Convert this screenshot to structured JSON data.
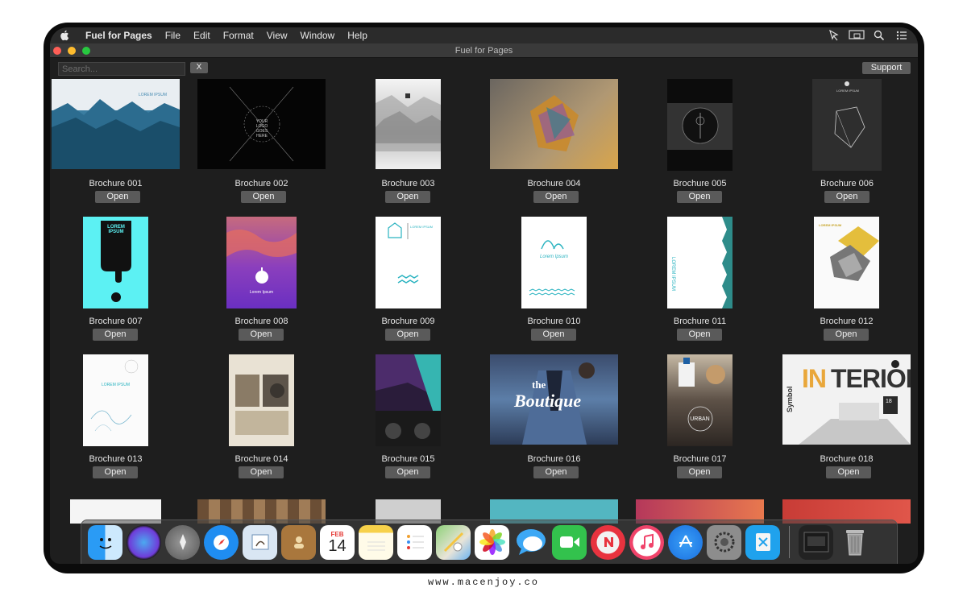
{
  "menubar": {
    "app_name": "Fuel for Pages",
    "items": [
      "File",
      "Edit",
      "Format",
      "View",
      "Window",
      "Help"
    ]
  },
  "window": {
    "title": "Fuel for Pages"
  },
  "toolbar": {
    "search_placeholder": "Search...",
    "clear_label": "X",
    "support_label": "Support"
  },
  "brochures": [
    {
      "label": "Brochure 001",
      "open": "Open"
    },
    {
      "label": "Brochure 002",
      "open": "Open"
    },
    {
      "label": "Brochure 003",
      "open": "Open"
    },
    {
      "label": "Brochure 004",
      "open": "Open"
    },
    {
      "label": "Brochure 005",
      "open": "Open"
    },
    {
      "label": "Brochure 006",
      "open": "Open"
    },
    {
      "label": "Brochure 007",
      "open": "Open"
    },
    {
      "label": "Brochure 008",
      "open": "Open"
    },
    {
      "label": "Brochure 009",
      "open": "Open"
    },
    {
      "label": "Brochure 010",
      "open": "Open"
    },
    {
      "label": "Brochure 011",
      "open": "Open"
    },
    {
      "label": "Brochure 012",
      "open": "Open"
    },
    {
      "label": "Brochure 013",
      "open": "Open"
    },
    {
      "label": "Brochure 014",
      "open": "Open"
    },
    {
      "label": "Brochure 015",
      "open": "Open"
    },
    {
      "label": "Brochure 016",
      "open": "Open"
    },
    {
      "label": "Brochure 017",
      "open": "Open"
    },
    {
      "label": "Brochure 018",
      "open": "Open"
    }
  ],
  "thumb_text": {
    "t001": "LOREM IPSUM",
    "t002": "YOUR LOGO GOES HERE",
    "t006": "LOREM IPSUM",
    "t007": "LOREM IPSUM",
    "t008": "Lorem Ipsum",
    "t009": "LOREM IPSUM",
    "t010": "Lorem Ipsum",
    "t011": "LOREM IPSUM",
    "t012": "LOREM IPSUM",
    "t013": "LOREM IPSUM",
    "t016a": "the",
    "t016b": "Boutique",
    "t017": "URBAN",
    "t018a": "IN",
    "t018b": "TERIOR",
    "t018c": "Symbol",
    "t018d": "18"
  },
  "dock": {
    "calendar_month": "FEB",
    "calendar_day": "14",
    "icons": [
      "finder-icon",
      "siri-icon",
      "launchpad-icon",
      "safari-icon",
      "mail-icon",
      "contacts-icon",
      "calendar-icon",
      "notes-icon",
      "reminders-icon",
      "maps-icon",
      "photos-icon",
      "messages-icon",
      "facetime-icon",
      "news-icon",
      "music-icon",
      "app-store-icon",
      "system-preferences-icon",
      "xcode-icon",
      "preview-icon",
      "trash-icon"
    ]
  },
  "footer": "www.macenjoy.co"
}
